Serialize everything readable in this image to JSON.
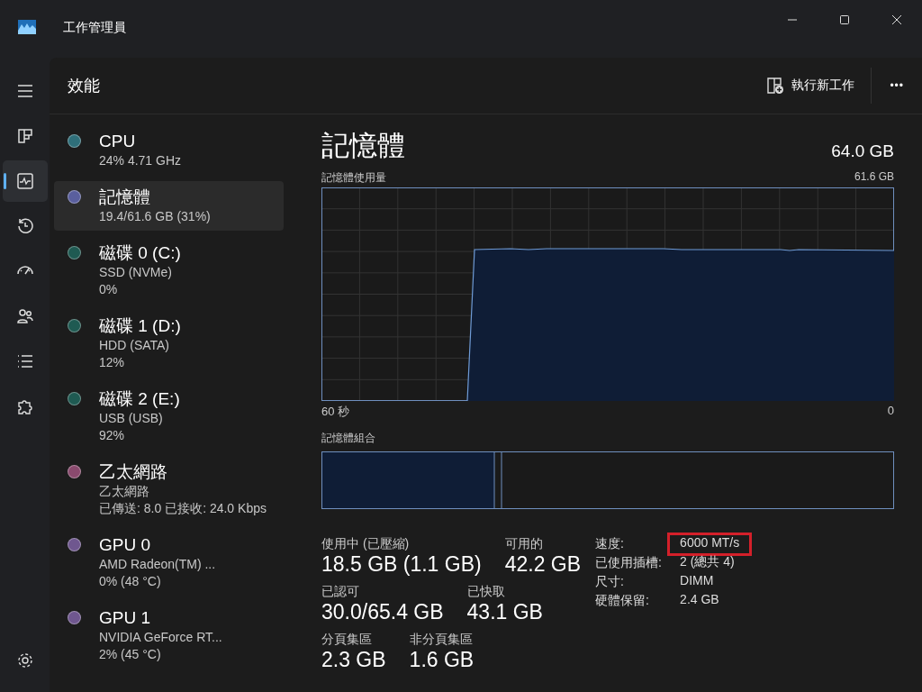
{
  "window": {
    "title": "工作管理員"
  },
  "nav": [
    {
      "kind": "menu",
      "selected": false
    },
    {
      "kind": "processes",
      "selected": false
    },
    {
      "kind": "performance",
      "selected": true
    },
    {
      "kind": "history",
      "selected": false
    },
    {
      "kind": "startup",
      "selected": false
    },
    {
      "kind": "users",
      "selected": false
    },
    {
      "kind": "details",
      "selected": false
    },
    {
      "kind": "services",
      "selected": false
    }
  ],
  "nav_bottom": {
    "kind": "settings",
    "selected": false
  },
  "header": {
    "title": "效能",
    "run_task": "執行新工作",
    "more": "•••"
  },
  "sidebar": {
    "items": [
      {
        "name": "CPU",
        "lines": [
          "24% 4.71 GHz"
        ],
        "color": "#2f6f7a",
        "selected": false
      },
      {
        "name": "記憶體",
        "lines": [
          "19.4/61.6 GB (31%)"
        ],
        "color": "#5a5f9e",
        "selected": true
      },
      {
        "name": "磁碟 0 (C:)",
        "lines": [
          "SSD (NVMe)",
          "0%"
        ],
        "color": "#1f5a52",
        "selected": false
      },
      {
        "name": "磁碟 1 (D:)",
        "lines": [
          "HDD (SATA)",
          "12%"
        ],
        "color": "#1f5a52",
        "selected": false
      },
      {
        "name": "磁碟 2 (E:)",
        "lines": [
          "USB (USB)",
          "92%"
        ],
        "color": "#1f5a52",
        "selected": false
      },
      {
        "name": "乙太網路",
        "lines": [
          "乙太網路",
          "已傳送: 8.0 已接收: 24.0 Kbps"
        ],
        "color": "#8a4a6e",
        "selected": false
      },
      {
        "name": "GPU 0",
        "lines": [
          "AMD Radeon(TM) ...",
          "0% (48 °C)"
        ],
        "color": "#6f578f",
        "selected": false
      },
      {
        "name": "GPU 1",
        "lines": [
          "NVIDIA GeForce RT...",
          "2% (45 °C)"
        ],
        "color": "#6f578f",
        "selected": false
      }
    ]
  },
  "detail": {
    "title": "記憶體",
    "total": "64.0 GB",
    "graph": {
      "label": "記憶體使用量",
      "max": "61.6 GB",
      "x_start": "60 秒",
      "x_end": "0"
    },
    "composition": {
      "label": "記憶體組合"
    },
    "stats": [
      [
        {
          "label": "使用中 (已壓縮)",
          "value": "18.5 GB (1.1 GB)"
        },
        {
          "label": "可用的",
          "value": "42.2 GB"
        }
      ],
      [
        {
          "label": "已認可",
          "value": "30.0/65.4 GB"
        },
        {
          "label": "已快取",
          "value": "43.1 GB"
        }
      ],
      [
        {
          "label": "分頁集區",
          "value": "2.3 GB"
        },
        {
          "label": "非分頁集區",
          "value": "1.6 GB"
        }
      ]
    ],
    "properties": [
      {
        "label": "速度:",
        "value": "6000 MT/s",
        "highlighted": true
      },
      {
        "label": "已使用插槽:",
        "value": "2 (總共 4)",
        "highlighted": false
      },
      {
        "label": "尺寸:",
        "value": "DIMM",
        "highlighted": false
      },
      {
        "label": "硬體保留:",
        "value": "2.4 GB",
        "highlighted": false
      }
    ]
  }
}
